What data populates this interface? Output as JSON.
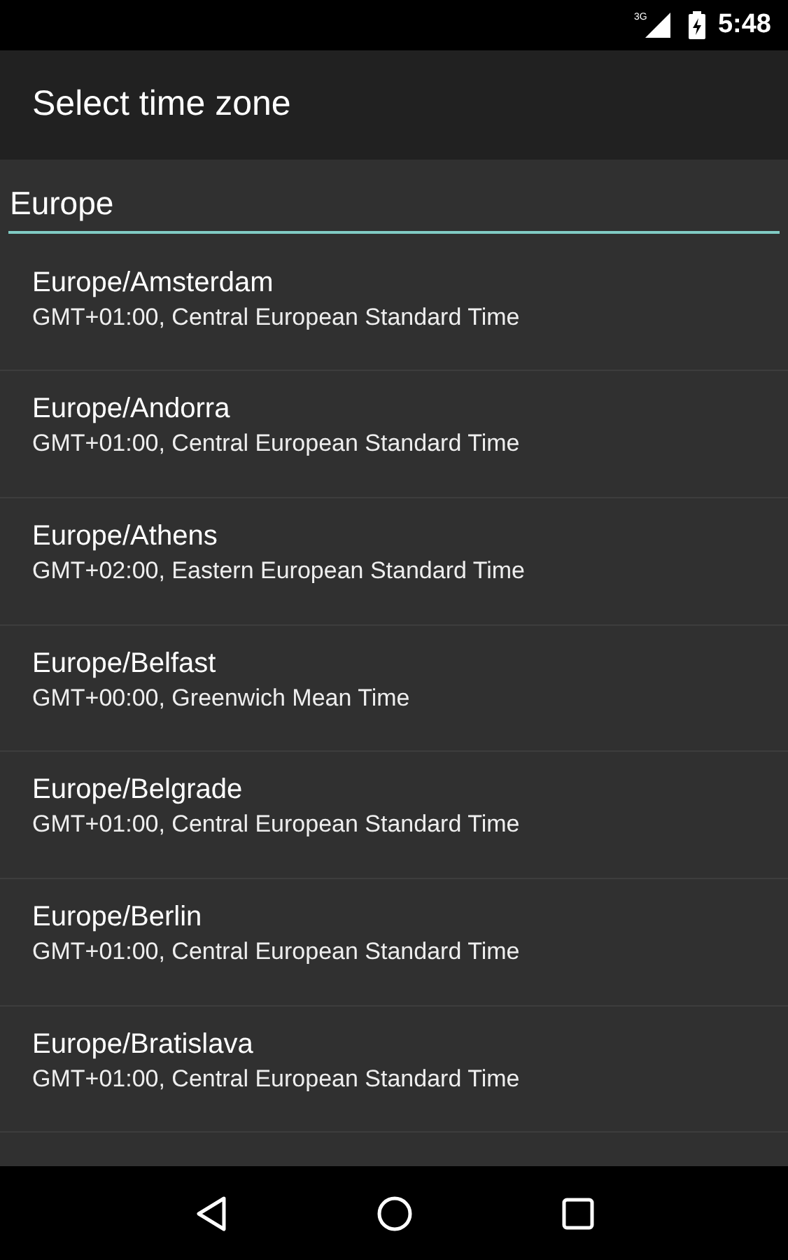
{
  "status_bar": {
    "time": "5:48",
    "network": "3G"
  },
  "app_bar": {
    "title": "Select time zone"
  },
  "search": {
    "value": "Europe"
  },
  "zones": [
    {
      "name": "Europe/Amsterdam",
      "detail": "GMT+01:00, Central European Standard Time"
    },
    {
      "name": "Europe/Andorra",
      "detail": "GMT+01:00, Central European Standard Time"
    },
    {
      "name": "Europe/Athens",
      "detail": "GMT+02:00, Eastern European Standard Time"
    },
    {
      "name": "Europe/Belfast",
      "detail": "GMT+00:00, Greenwich Mean Time"
    },
    {
      "name": "Europe/Belgrade",
      "detail": "GMT+01:00, Central European Standard Time"
    },
    {
      "name": "Europe/Berlin",
      "detail": "GMT+01:00, Central European Standard Time"
    },
    {
      "name": "Europe/Bratislava",
      "detail": "GMT+01:00, Central European Standard Time"
    }
  ]
}
